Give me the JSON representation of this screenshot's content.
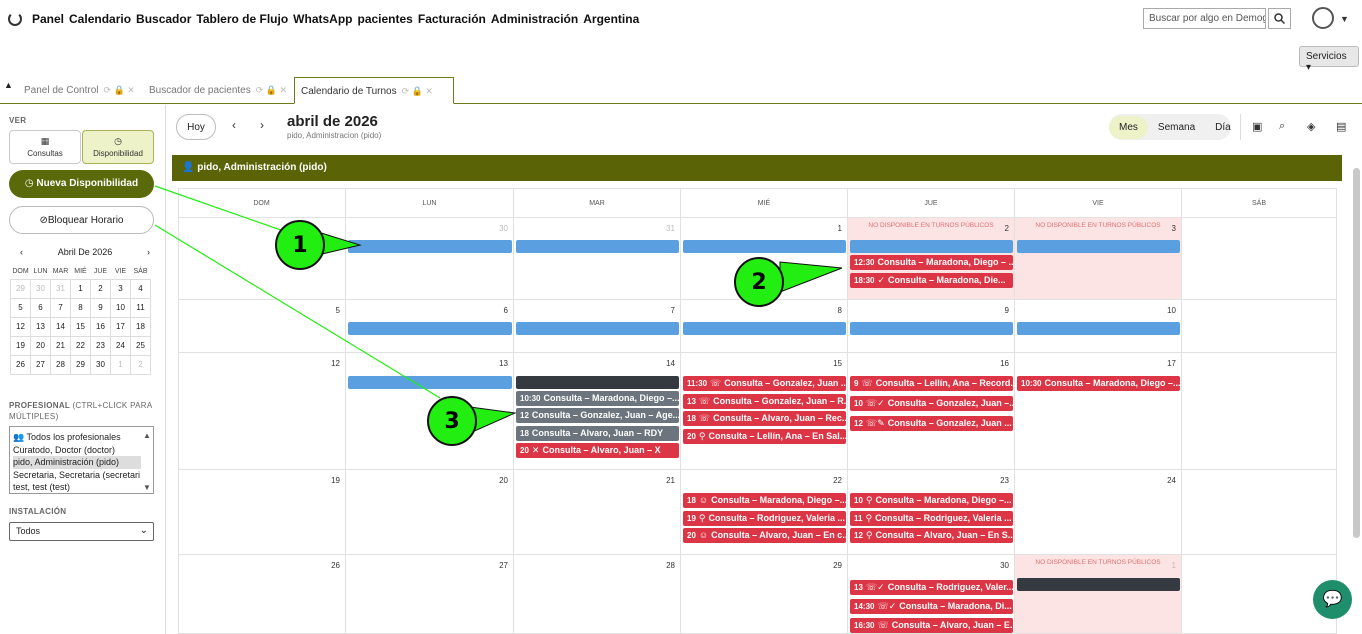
{
  "nav": {
    "items": [
      "Panel",
      "Calendario",
      "Buscador",
      "Tablero de Flujo",
      "WhatsApp",
      "pacientes",
      "Facturación",
      "Administración",
      "Argentina"
    ],
    "search_placeholder": "Buscar por algo en Demogra"
  },
  "servicios_label": "Servicios",
  "tabs": [
    "Panel de Control",
    "Buscador de pacientes",
    "Calendario de Turnos"
  ],
  "sidebar": {
    "ver_label": "VER",
    "consultas": "Consultas",
    "disponibilidad": "Disponibilidad",
    "nueva": "Nueva Disponibilidad",
    "bloquear": "Bloquear Horario",
    "mini_title": "Abril De 2026",
    "mini_dow": [
      "DOM",
      "LUN",
      "MAR",
      "MIÉ",
      "JUE",
      "VIE",
      "SÁB"
    ],
    "mini_weeks": [
      [
        "29",
        "30",
        "31",
        "1",
        "2",
        "3",
        "4"
      ],
      [
        "5",
        "6",
        "7",
        "8",
        "9",
        "10",
        "11"
      ],
      [
        "12",
        "13",
        "14",
        "15",
        "16",
        "17",
        "18"
      ],
      [
        "19",
        "20",
        "21",
        "22",
        "23",
        "24",
        "25"
      ],
      [
        "26",
        "27",
        "28",
        "29",
        "30",
        "1",
        "2"
      ]
    ],
    "profesional_label": "PROFESIONAL",
    "profesional_hint": "(CTRL+CLICK PARA MÚLTIPLES)",
    "profesionales": [
      "Todos los profesionales",
      "Curatodo, Doctor (doctor)",
      "pido, Administración (pido)",
      "Secretaria, Secretaria (secretari",
      "test, test (test)"
    ],
    "instalacion_label": "INSTALACIÓN",
    "instalacion_value": "Todos"
  },
  "calendar": {
    "hoy": "Hoy",
    "title": "abril de 2026",
    "subtitle": "pido, Administracion (pido)",
    "views": [
      "Mes",
      "Semana",
      "Día"
    ],
    "group_header": "pido, Administración (pido)",
    "dow": [
      "DOM",
      "LUN",
      "MAR",
      "MIÉ",
      "JUE",
      "VIE",
      "SÁB"
    ],
    "nd_label": "NO DISPONIBLE EN TURNOS PÚBLICOS",
    "weeks": [
      [
        "",
        "30",
        "31",
        "1",
        "2",
        "3",
        ""
      ],
      [
        "5",
        "6",
        "7",
        "8",
        "9",
        "10",
        ""
      ],
      [
        "12",
        "13",
        "14",
        "15",
        "16",
        "17",
        ""
      ],
      [
        "19",
        "20",
        "21",
        "22",
        "23",
        "24",
        ""
      ],
      [
        "26",
        "27",
        "28",
        "29",
        "30",
        "1",
        ""
      ]
    ],
    "events": {
      "w0_jue_1": {
        "t": "12:30",
        "txt": "Consulta – Maradona, Diego – ..."
      },
      "w0_jue_2": {
        "t": "18:30",
        "g": "✓",
        "txt": "Consulta – Maradona, Die..."
      },
      "w2_mar_1": {
        "t": "10:30",
        "txt": "Consulta – Maradona, Diego –..."
      },
      "w2_mar_2": {
        "t": "12",
        "txt": "Consulta – Gonzalez, Juan – Age..."
      },
      "w2_mar_3": {
        "t": "18",
        "txt": "Consulta – Alvaro, Juan – RDY"
      },
      "w2_mar_4": {
        "t": "20",
        "g": "✕",
        "txt": "Consulta – Alvaro, Juan – X"
      },
      "w2_mie_1": {
        "t": "11:30",
        "g": "☏",
        "txt": "Consulta – Gonzalez, Juan ..."
      },
      "w2_mie_2": {
        "t": "13",
        "g": "☏",
        "txt": "Consulta – Gonzalez, Juan – R..."
      },
      "w2_mie_3": {
        "t": "18",
        "g": "☏",
        "txt": "Consulta – Alvaro, Juan – Rec..."
      },
      "w2_mie_4": {
        "t": "20",
        "g": "⚲",
        "txt": "Consulta – Lellín, Ana – En Sal..."
      },
      "w2_jue_1": {
        "t": "9",
        "g": "☏",
        "txt": "Consulta – Lellín, Ana – Record..."
      },
      "w2_jue_2": {
        "t": "10",
        "g": "☏✓",
        "txt": "Consulta – Gonzalez, Juan –..."
      },
      "w2_jue_3": {
        "t": "12",
        "g": "☏✎",
        "txt": "Consulta – Gonzalez, Juan ..."
      },
      "w2_vie_1": {
        "t": "10:30",
        "txt": "Consulta – Maradona, Diego –..."
      },
      "w3_mie_1": {
        "t": "18",
        "g": "☺",
        "txt": "Consulta – Maradona, Diego –..."
      },
      "w3_mie_2": {
        "t": "19",
        "g": "⚲",
        "txt": "Consulta – Rodriguez, Valeria ..."
      },
      "w3_mie_3": {
        "t": "20",
        "g": "☺",
        "txt": "Consulta – Alvaro, Juan – En c..."
      },
      "w3_jue_1": {
        "t": "10",
        "g": "⚲",
        "txt": "Consulta – Maradona, Diego –..."
      },
      "w3_jue_2": {
        "t": "11",
        "g": "⚲",
        "txt": "Consulta – Rodriguez, Valeria ..."
      },
      "w3_jue_3": {
        "t": "12",
        "g": "⚲",
        "txt": "Consulta – Alvaro, Juan – En S..."
      },
      "w4_jue_1": {
        "t": "13",
        "g": "☏✓",
        "txt": "Consulta – Rodriguez, Valer..."
      },
      "w4_jue_2": {
        "t": "14:30",
        "g": "☏✓",
        "txt": "Consulta – Maradona, Di..."
      },
      "w4_jue_3": {
        "t": "16:30",
        "g": "☏",
        "txt": "Consulta – Alvaro, Juan – E..."
      }
    }
  },
  "annotations": [
    "1",
    "2",
    "3"
  ]
}
